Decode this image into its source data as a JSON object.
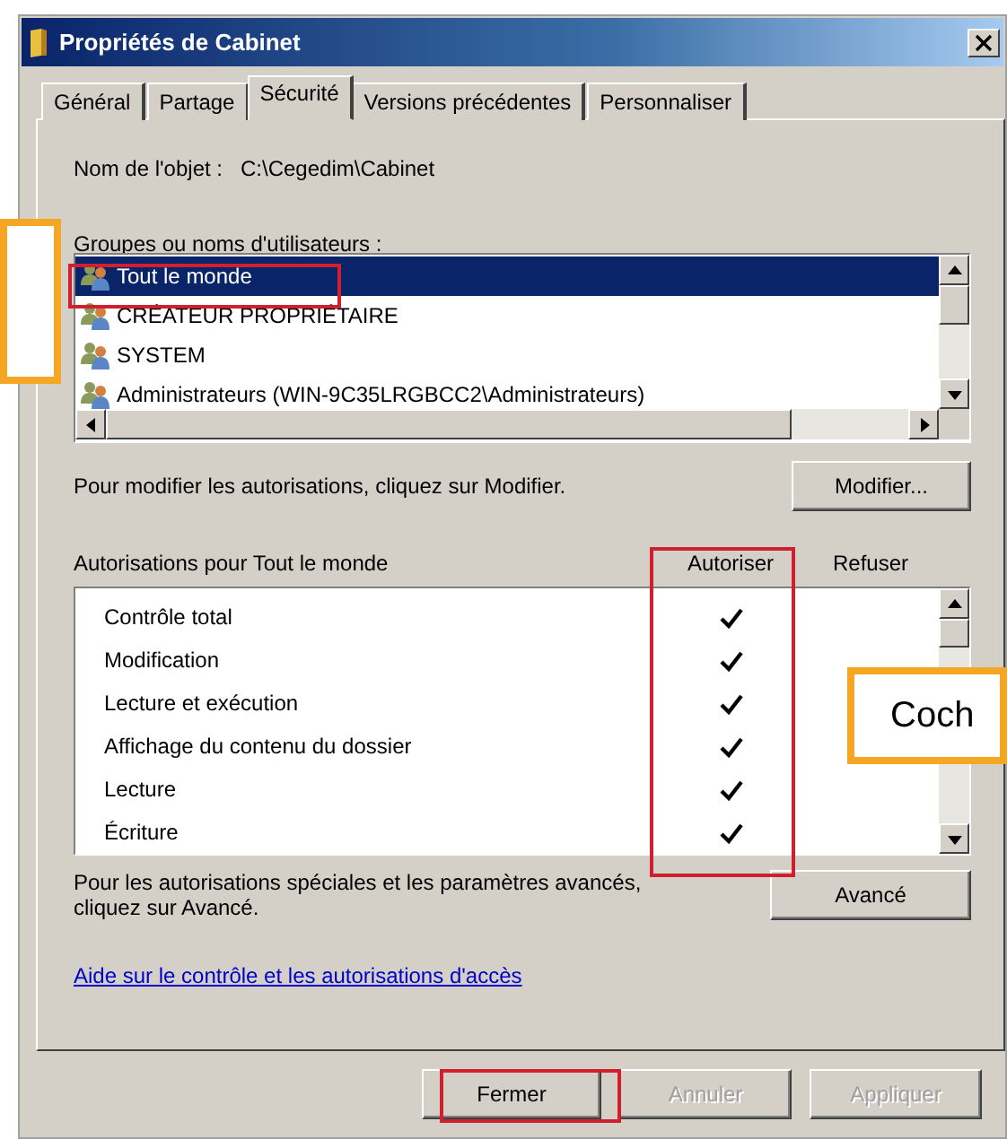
{
  "window": {
    "title": "Propriétés de Cabinet"
  },
  "tabs": [
    {
      "label": "Général",
      "selected": false
    },
    {
      "label": "Partage",
      "selected": false
    },
    {
      "label": "Sécurité",
      "selected": true
    },
    {
      "label": "Versions précédentes",
      "selected": false
    },
    {
      "label": "Personnaliser",
      "selected": false
    }
  ],
  "object_name": {
    "label": "Nom de l'objet :",
    "value": "C:\\Cegedim\\Cabinet"
  },
  "groups": {
    "label": "Groupes ou noms d'utilisateurs :",
    "items": [
      {
        "name": "Tout le monde",
        "selected": true
      },
      {
        "name": "CRÉATEUR PROPRIÉTAIRE",
        "selected": false
      },
      {
        "name": "SYSTEM",
        "selected": false
      },
      {
        "name": "Administrateurs (WIN-9C35LRGBCC2\\Administrateurs)",
        "selected": false
      }
    ]
  },
  "modify_hint": "Pour modifier les autorisations, cliquez sur Modifier.",
  "modify_button": "Modifier...",
  "permissions": {
    "label": "Autorisations pour Tout le monde",
    "columns": [
      "Autoriser",
      "Refuser"
    ],
    "rows": [
      {
        "name": "Contrôle total",
        "allow": true,
        "deny": false
      },
      {
        "name": "Modification",
        "allow": true,
        "deny": false
      },
      {
        "name": "Lecture et exécution",
        "allow": true,
        "deny": false
      },
      {
        "name": "Affichage du contenu du dossier",
        "allow": true,
        "deny": false
      },
      {
        "name": "Lecture",
        "allow": true,
        "deny": false
      },
      {
        "name": "Écriture",
        "allow": true,
        "deny": false
      }
    ]
  },
  "advanced_hint": "Pour les autorisations spéciales et les paramètres avancés, cliquez sur Avancé.",
  "advanced_button": "Avancé",
  "help_link": "Aide sur le contrôle et les autorisations d'accès",
  "buttons": [
    {
      "label": "Fermer",
      "disabled": false
    },
    {
      "label": "Annuler",
      "disabled": true
    },
    {
      "label": "Appliquer",
      "disabled": true
    }
  ],
  "callout": {
    "text": "Coch"
  }
}
